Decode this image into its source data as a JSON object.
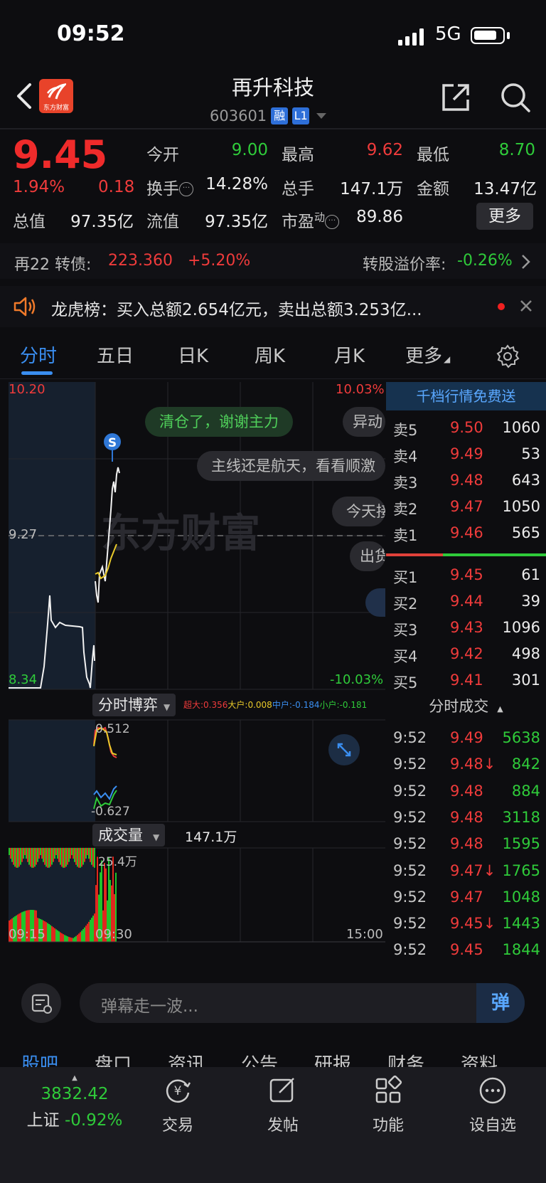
{
  "status_bar": {
    "time": "09:52",
    "network": "5G"
  },
  "header": {
    "title": "再升科技",
    "code": "603601",
    "tag_rong": "融",
    "tag_level": "L1",
    "logo_text": "东方财富"
  },
  "quote": {
    "price": "9.45",
    "change_pct": "1.94%",
    "change": "0.18",
    "open_label": "今开",
    "open": "9.00",
    "high_label": "最高",
    "high": "9.62",
    "low_label": "最低",
    "low": "8.70",
    "turnover_label": "换手",
    "turnover": "14.28%",
    "volume_label": "总手",
    "volume": "147.1万",
    "amount_label": "金额",
    "amount": "13.47亿",
    "mktcap_label": "总值",
    "mktcap": "97.35亿",
    "float_label": "流值",
    "float": "97.35亿",
    "pe_label": "市盈",
    "pe_sup": "动",
    "pe": "89.86",
    "more_label": "更多"
  },
  "bond": {
    "name": "再22 转债:",
    "price": "223.360",
    "change": "+5.20%",
    "premium_label": "转股溢价率:",
    "premium": "-0.26%"
  },
  "lhb": {
    "text": "龙虎榜：买入总额2.654亿元，卖出总额3.253亿..."
  },
  "tabs": [
    "分时",
    "五日",
    "日K",
    "周K",
    "月K",
    "更多"
  ],
  "chart": {
    "price_high": "10.20",
    "price_mid": "9.27",
    "price_low": "8.34",
    "pct_high": "10.03%",
    "pct_low": "-10.03%",
    "marker": "S",
    "watermark": "东方财富",
    "game_label": "分时博弈",
    "game_legend": {
      "super": "超大:0.356",
      "big": "大户:0.008",
      "mid": "中户:-0.184",
      "small": "小户:-0.181"
    },
    "game_top": "0.512",
    "game_bottom": "-0.627",
    "vol_label": "成交量",
    "vol_total": "147.1万",
    "vol_max": "25.4万",
    "time_start": "09:15",
    "time_open": "09:30",
    "time_end": "15:00"
  },
  "danmaku": [
    "清仓了，谢谢主力",
    "异动",
    "主线还是航天，看看顺激",
    "今天接",
    "出货"
  ],
  "orderbook": {
    "banner": "千档行情免费送",
    "asks": [
      {
        "label": "卖5",
        "price": "9.50",
        "vol": "1060"
      },
      {
        "label": "卖4",
        "price": "9.49",
        "vol": "53"
      },
      {
        "label": "卖3",
        "price": "9.48",
        "vol": "643"
      },
      {
        "label": "卖2",
        "price": "9.47",
        "vol": "1050"
      },
      {
        "label": "卖1",
        "price": "9.46",
        "vol": "565"
      }
    ],
    "bids": [
      {
        "label": "买1",
        "price": "9.45",
        "vol": "61"
      },
      {
        "label": "买2",
        "price": "9.44",
        "vol": "39"
      },
      {
        "label": "买3",
        "price": "9.43",
        "vol": "1096"
      },
      {
        "label": "买4",
        "price": "9.42",
        "vol": "498"
      },
      {
        "label": "买5",
        "price": "9.41",
        "vol": "301"
      }
    ],
    "trades_label": "分时成交",
    "trades": [
      {
        "time": "9:52",
        "price": "9.49",
        "vol": "5638"
      },
      {
        "time": "9:52",
        "price": "9.48↓",
        "vol": "842"
      },
      {
        "time": "9:52",
        "price": "9.48",
        "vol": "884"
      },
      {
        "time": "9:52",
        "price": "9.48",
        "vol": "3118"
      },
      {
        "time": "9:52",
        "price": "9.48",
        "vol": "1595"
      },
      {
        "time": "9:52",
        "price": "9.47↓",
        "vol": "1765"
      },
      {
        "time": "9:52",
        "price": "9.47",
        "vol": "1048"
      },
      {
        "time": "9:52",
        "price": "9.45↓",
        "vol": "1443"
      },
      {
        "time": "9:52",
        "price": "9.45",
        "vol": "1844"
      }
    ]
  },
  "comment": {
    "placeholder": "弹幕走一波...",
    "danmaku_btn": "弹"
  },
  "bottom_tabs": [
    "股吧",
    "盘口",
    "资讯",
    "公告",
    "研报",
    "财务",
    "资料"
  ],
  "index": {
    "value": "3832.42",
    "name": "上证",
    "change": "-0.92%"
  },
  "nav": [
    "交易",
    "发帖",
    "功能",
    "设自选"
  ]
}
